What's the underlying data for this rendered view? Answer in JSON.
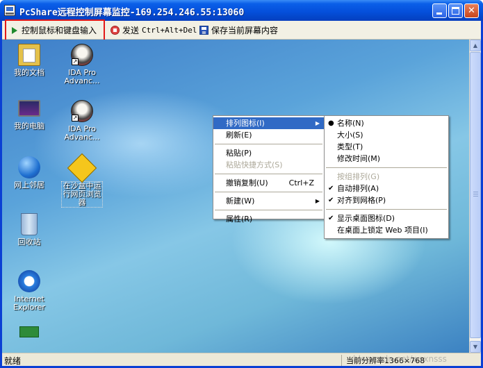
{
  "window": {
    "title": "PcShare远程控制屏幕监控-169.254.246.55:13060",
    "minimize_label": "",
    "maximize_label": "",
    "close_label": "✕"
  },
  "toolbar": {
    "control_label": "控制鼠标和键盘输入",
    "send_prefix": "发送",
    "send_keys": "Ctrl+Alt+Del",
    "save_label": "保存当前屏幕内容"
  },
  "desktop": {
    "icons": [
      {
        "label": "我的文档"
      },
      {
        "label": "IDA Pro Advanc..."
      },
      {
        "label": "我的电脑"
      },
      {
        "label": "IDA Pro Advanc..."
      },
      {
        "label": "网上邻居"
      },
      {
        "label": "在沙盒中运行网页浏览器"
      },
      {
        "label": "回收站"
      },
      {
        "label": "Internet Explorer"
      }
    ]
  },
  "context_menu": {
    "items": [
      {
        "label": "排列图标(I)"
      },
      {
        "label": "刷新(E)"
      },
      {
        "label": "粘贴(P)"
      },
      {
        "label": "粘贴快捷方式(S)"
      },
      {
        "label": "撤销复制(U)",
        "shortcut": "Ctrl+Z"
      },
      {
        "label": "新建(W)"
      },
      {
        "label": "属性(R)"
      }
    ]
  },
  "submenu": {
    "items": [
      {
        "label": "名称(N)",
        "mark": "●"
      },
      {
        "label": "大小(S)"
      },
      {
        "label": "类型(T)"
      },
      {
        "label": "修改时间(M)"
      },
      {
        "label": "按组排列(G)"
      },
      {
        "label": "自动排列(A)",
        "mark": "✔"
      },
      {
        "label": "对齐到网格(P)",
        "mark": "✔"
      },
      {
        "label": "显示桌面图标(D)",
        "mark": "✔"
      },
      {
        "label": "在桌面上锁定 Web 项目(I)"
      }
    ]
  },
  "status": {
    "left": "就绪",
    "resolution": "当前分辨率1366×768",
    "watermark": "blog.csdn.net/wsxnsss"
  },
  "colors": {
    "title_blue": "#0550dc",
    "menu_highlight": "#316ac5",
    "annotation_red": "#e21919"
  }
}
